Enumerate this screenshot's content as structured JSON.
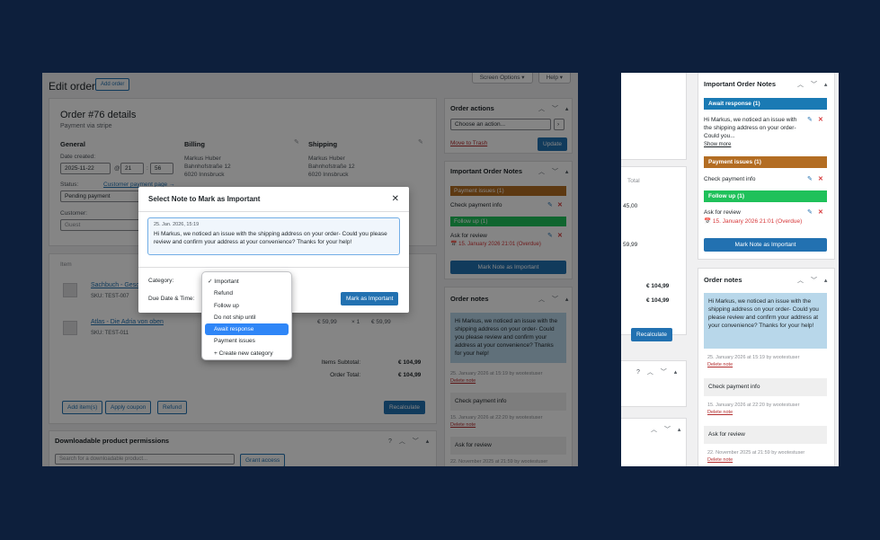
{
  "colors": {
    "accent": "#2271b1",
    "issues": "#b36d23",
    "follow": "#1fc15a",
    "await": "#1a7ab4",
    "danger": "#d63638",
    "notebg": "#b8d7ea",
    "graynote": "#efefef"
  },
  "left": {
    "screen_options": "Screen Options ▾",
    "help": "Help ▾",
    "page_title": "Edit order",
    "add_order": "Add order",
    "order_title": "Order #76 details",
    "order_sub": "Payment via stripe",
    "general": {
      "heading": "General",
      "date_label": "Date created:",
      "date": "2025-11-22",
      "at": "@",
      "hour": "21",
      "minute": "56",
      "status_label": "Status:",
      "customer_link": "Customer payment page →",
      "status": "Pending payment",
      "customer_label": "Customer:",
      "customer": "Guest"
    },
    "billing": {
      "heading": "Billing",
      "lines": [
        "Markus Huber",
        "Bahnhofstraße 12",
        "6020 Innsbruck"
      ]
    },
    "shipping": {
      "heading": "Shipping",
      "lines": [
        "Markus Huber",
        "Bahnhofstraße 12",
        "6020 Innsbruck"
      ]
    },
    "items_header": "Item",
    "items": [
      {
        "name": "Sachbuch - Gesc",
        "sku": "SKU: TEST-007"
      },
      {
        "name": "Atlas - Die Adria von oben",
        "sku": "SKU: TEST-011",
        "price": "€ 59,99",
        "qty": "× 1",
        "total": "€ 59,99"
      }
    ],
    "subtotal_label": "Items Subtotal:",
    "subtotal": "€ 104,99",
    "total_label": "Order Total:",
    "total": "€ 104,99",
    "btn_add_items": "Add item(s)",
    "btn_coupon": "Apply coupon",
    "btn_refund": "Refund",
    "btn_recalculate": "Recalculate",
    "downloads_title": "Downloadable product permissions",
    "downloads_placeholder": "Search for a downloadable product...",
    "grant_access": "Grant access",
    "order_actions": {
      "title": "Order actions",
      "select": "Choose an action...",
      "go": "›",
      "trash": "Move to Trash",
      "update": "Update"
    },
    "important_notes": {
      "title": "Important Order Notes",
      "band1": "Payment issues (1)",
      "note1": "Check payment info",
      "band2": "Follow up (1)",
      "note2": "Ask for review",
      "due2": "📅 15. January 2026 21:01 (Overdue)",
      "button": "Mark Note as Important"
    },
    "order_notes": {
      "title": "Order notes",
      "note1": "Hi Markus, we noticed an issue with the shipping address on your order- Could you please review and confirm your address at your convenience? Thanks for your help!",
      "meta1": "25. January 2026 at 15:19 by wootestuser",
      "note2": "Check payment info",
      "meta2": "15. January 2026 at 22:20 by wootestuser",
      "note3": "Ask for review",
      "meta3": "22. November 2025 at 21:59 by wootestuser",
      "delete": "Delete note"
    },
    "modal": {
      "title": "Select Note to Mark as Important",
      "close": "✕",
      "note_date": "25. Jan. 2026, 15:19",
      "note_text": "Hi Markus, we noticed an issue with the shipping address on your order- Could you please review and confirm your address at your convenience? Thanks for your help!",
      "category_label": "Category:",
      "due_label": "Due Date & Time:",
      "submit": "Mark as Important",
      "options": [
        {
          "label": "Important",
          "checked": true,
          "selected": false
        },
        {
          "label": "Refund",
          "checked": false,
          "selected": false
        },
        {
          "label": "Follow up",
          "checked": false,
          "selected": false
        },
        {
          "label": "Do not ship until",
          "checked": false,
          "selected": false
        },
        {
          "label": "Await response",
          "checked": false,
          "selected": true
        },
        {
          "label": "Payment issues",
          "checked": false,
          "selected": false
        },
        {
          "label": "+ Create new category",
          "checked": false,
          "selected": false
        }
      ]
    }
  },
  "right": {
    "total_header": "Total",
    "row1": "45,00",
    "row2": "59,99",
    "sub1": "€ 104,99",
    "sub2": "€ 104,99",
    "recalculate": "Recalculate",
    "important_notes": {
      "title": "Important Order Notes",
      "band1": "Await response (1)",
      "note1": "Hi Markus, we noticed an issue with the shipping address on your order- Could you...",
      "show_more": "Show more",
      "band2": "Payment issues (1)",
      "note2": "Check payment info",
      "band3": "Follow up (1)",
      "note3": "Ask for review",
      "due3": "📅 15. January 2026 21:01 (Overdue)",
      "button": "Mark Note as Important"
    },
    "order_notes": {
      "title": "Order notes",
      "note1": "Hi Markus, we noticed an issue with the shipping address on your order- Could you please review and confirm your address at your convenience? Thanks for your help!",
      "meta1": "25. January 2026 at 15:19 by wootestuser",
      "note2": "Check payment info",
      "meta2": "15. January 2026 at 22:20 by wootestuser",
      "note3": "Ask for review",
      "meta3": "22. November 2025 at 21:59 by wootestuser",
      "delete": "Delete note"
    }
  }
}
